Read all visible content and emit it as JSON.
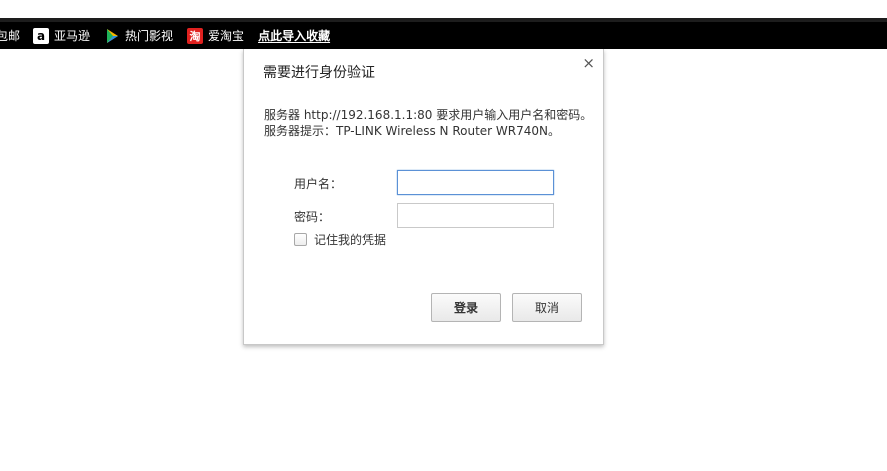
{
  "bookmarks_bar": {
    "items": [
      {
        "label": "包邮",
        "icon": ""
      },
      {
        "label": "亚马逊",
        "icon": "amazon-icon",
        "glyph": "a"
      },
      {
        "label": "热门影视",
        "icon": "video-play-icon"
      },
      {
        "label": "爱淘宝",
        "icon": "taobao-icon",
        "glyph": "淘"
      },
      {
        "label": "点此导入收藏",
        "icon": ""
      }
    ]
  },
  "dialog": {
    "title": "需要进行身份验证",
    "close_glyph": "×",
    "message_line1": "服务器 http://192.168.1.1:80 要求用户输入用户名和密码。",
    "message_line2": "服务器提示：TP-LINK Wireless N Router WR740N。",
    "username_label": "用户名：",
    "username_value": "",
    "password_label": "密码：",
    "password_value": "",
    "remember_label": "记住我的凭据",
    "remember_checked": false,
    "login_button": "登录",
    "cancel_button": "取消"
  },
  "colors": {
    "bookmarks_bg": "#000000",
    "focus_border": "#5b91d6",
    "taobao_red": "#e0211f"
  }
}
